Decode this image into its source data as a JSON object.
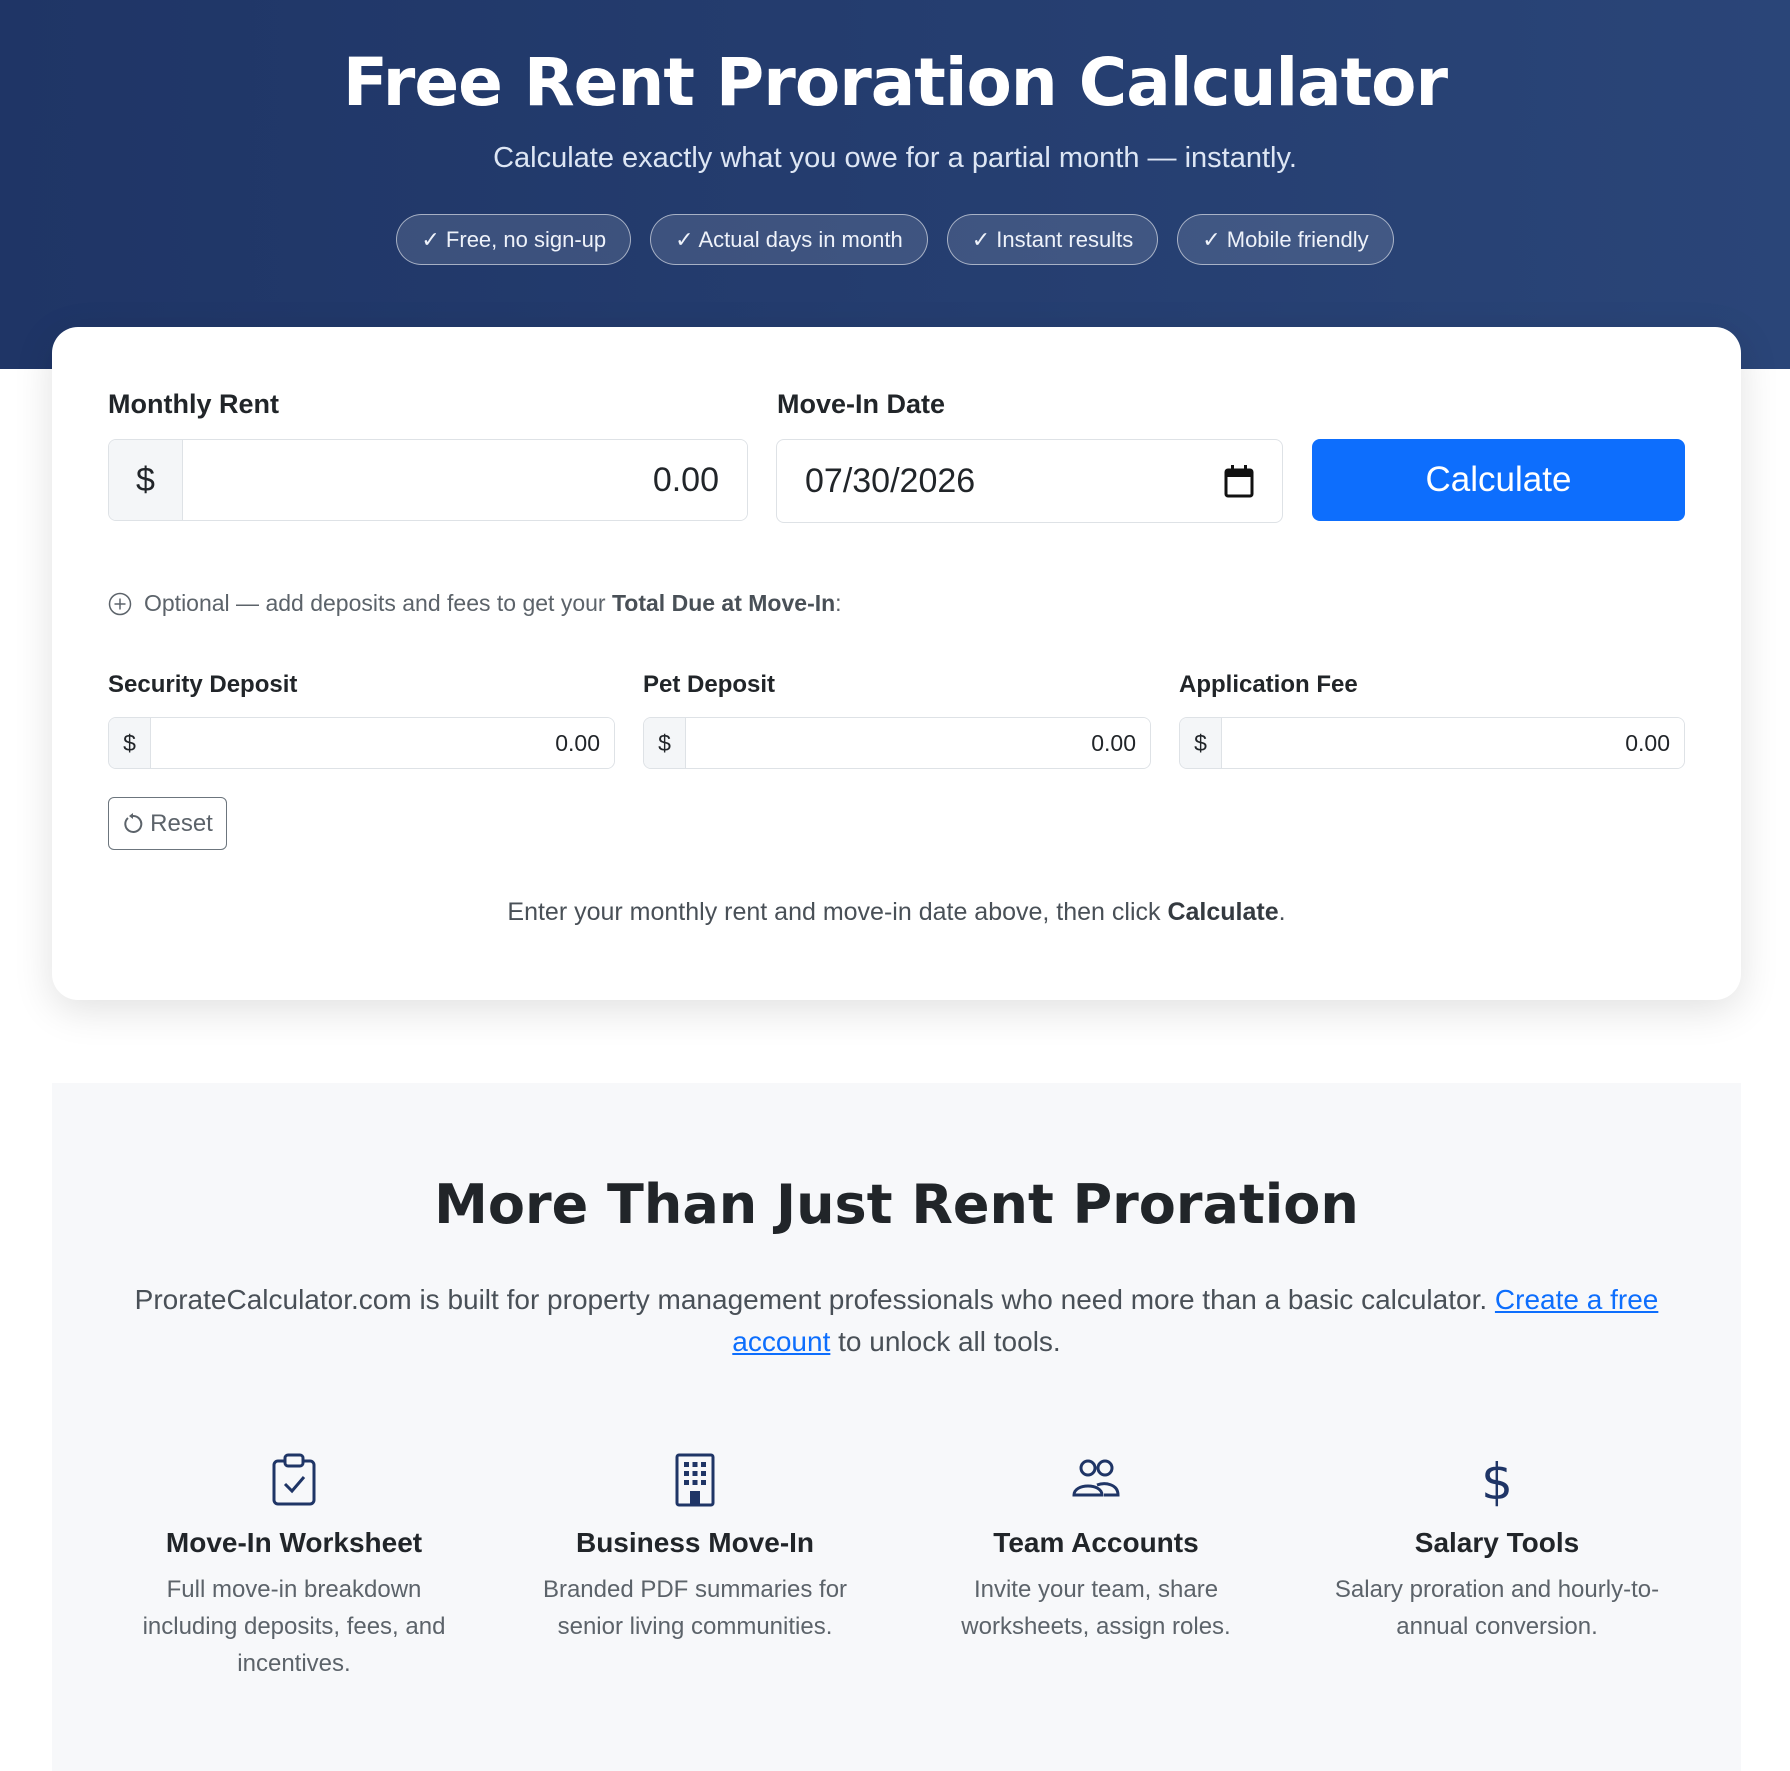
{
  "hero": {
    "title": "Free Rent Proration Calculator",
    "subtitle": "Calculate exactly what you owe for a partial month — instantly.",
    "badges": [
      "✓ Free, no sign-up",
      "✓ Actual days in month",
      "✓ Instant results",
      "✓ Mobile friendly"
    ]
  },
  "calculator": {
    "monthly_rent_label": "Monthly Rent",
    "currency_symbol": "$",
    "monthly_rent_value": "0.00",
    "move_in_label": "Move-In Date",
    "move_in_value": "07/30/2026",
    "calculate_label": "Calculate",
    "optional_prefix": "Optional — add deposits and fees to get your ",
    "optional_bold": "Total Due at Move-In",
    "optional_suffix": ":",
    "security_deposit_label": "Security Deposit",
    "security_deposit_value": "0.00",
    "pet_deposit_label": "Pet Deposit",
    "pet_deposit_value": "0.00",
    "application_fee_label": "Application Fee",
    "application_fee_value": "0.00",
    "reset_label": "Reset",
    "hint_prefix": "Enter your monthly rent and move-in date above, then click ",
    "hint_bold": "Calculate",
    "hint_suffix": "."
  },
  "features": {
    "title": "More Than Just Rent Proration",
    "desc_prefix": "ProrateCalculator.com is built for property management professionals who need more than a basic calculator. ",
    "desc_link": "Create a free account",
    "desc_suffix": " to unlock all tools.",
    "items": [
      {
        "icon": "clipboard-check-icon",
        "name": "Move-In Worksheet",
        "text": "Full move-in breakdown including deposits, fees, and incentives."
      },
      {
        "icon": "building-icon",
        "name": "Business Move-In",
        "text": "Branded PDF summaries for senior living communities."
      },
      {
        "icon": "people-icon",
        "name": "Team Accounts",
        "text": "Invite your team, share worksheets, assign roles."
      },
      {
        "icon": "dollar-icon",
        "name": "Salary Tools",
        "text": "Salary proration and hourly-to-annual conversion."
      }
    ]
  },
  "colors": {
    "hero_bg": "#1f3566",
    "primary": "#0d6efd",
    "icon": "#1f3566",
    "section_bg": "#f7f8fa"
  }
}
